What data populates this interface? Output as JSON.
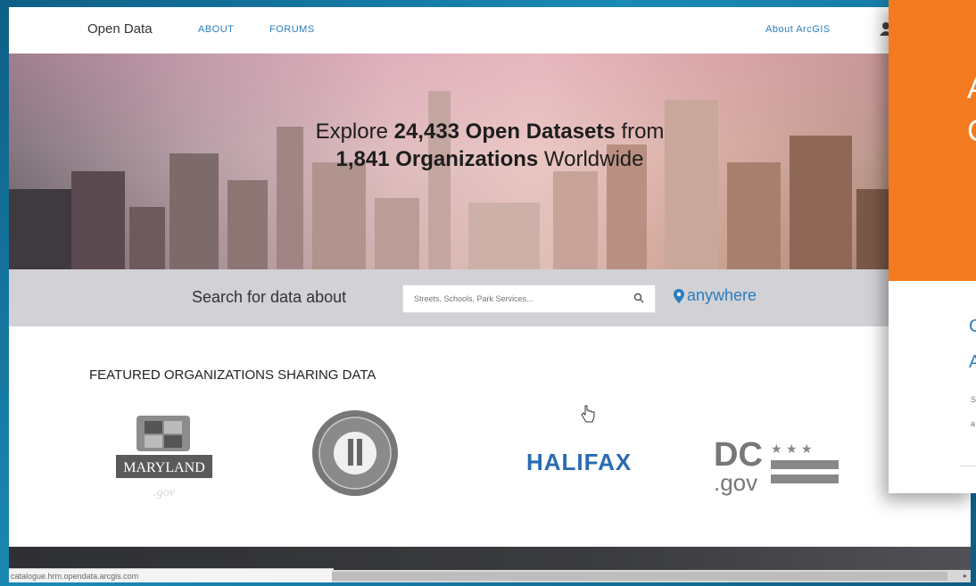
{
  "nav": {
    "brand": "Open Data",
    "about": "ABOUT",
    "forums": "FORUMS",
    "about_arcgis": "About ArcGIS"
  },
  "hero": {
    "line1_pre": "Explore ",
    "line1_bold": "24,433 Open Datasets",
    "line1_post": " from",
    "line2_bold": "1,841 Organizations",
    "line2_post": " Worldwide"
  },
  "search": {
    "label": "Search for data about",
    "placeholder": "Streets, Schools, Park Services...",
    "location": "anywhere"
  },
  "featured": {
    "heading": "FEATURED ORGANIZATIONS SHARING DATA",
    "orgs": [
      {
        "name": "MARYLAND"
      },
      {
        "name": "Kentucky seal"
      },
      {
        "name": "HALIFAX"
      },
      {
        "name": "DC .gov"
      }
    ]
  },
  "status_url": "catalogue.hrm.opendata.arcgis.com",
  "overlay": {
    "char1": "A",
    "char2": "C",
    "blue1": "C",
    "blue2": "A",
    "small1": "S",
    "small2": "a"
  },
  "colors": {
    "accent": "#2a7dbf",
    "overlay_orange": "#f37a1f",
    "halifax_blue": "#2a6bb3"
  }
}
